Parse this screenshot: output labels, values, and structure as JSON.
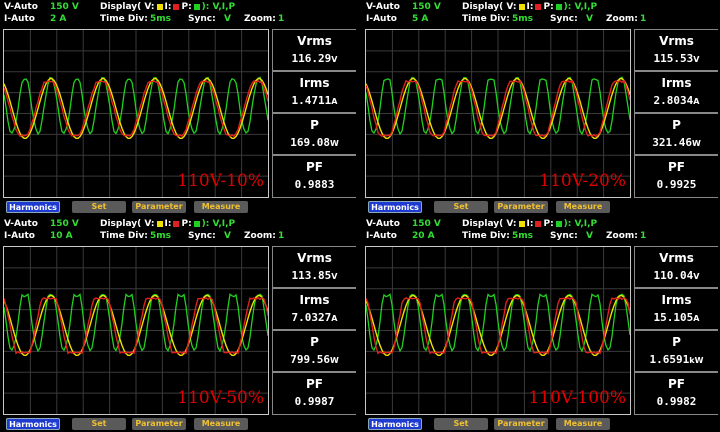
{
  "labels": {
    "v_auto": "V-Auto",
    "i_auto": "I-Auto",
    "display": "Display( V:",
    "display_i": "I:",
    "display_p": "P:",
    "display_end": "): V,I,P",
    "time_div": "Time Div:",
    "time_div_value": "5ms",
    "sync": "Sync:",
    "sync_value": "V",
    "zoom": "Zoom:",
    "zoom_value": "1",
    "m_vrms": "Vrms",
    "m_irms": "Irms",
    "m_p": "P",
    "m_pf": "PF",
    "btn_harmonics": "Harmonics",
    "btn_set": "Set",
    "btn_parameter": "Parameter",
    "btn_measure": "Measure"
  },
  "colors": {
    "voltage": "#f0e000",
    "current": "#e02020",
    "power": "#20d020",
    "panel_label": "#e00000"
  },
  "panels": [
    {
      "v_range": "150 V",
      "i_range": "2 A",
      "label": "110V-10%",
      "vrms": "116.29",
      "vrms_unit": "V",
      "irms": "1.4711",
      "irms_unit": "A",
      "p": "169.08",
      "p_unit": "W",
      "pf": "0.9883"
    },
    {
      "v_range": "150 V",
      "i_range": "5 A",
      "label": "110V-20%",
      "vrms": "115.53",
      "vrms_unit": "V",
      "irms": "2.8034",
      "irms_unit": "A",
      "p": "321.46",
      "p_unit": "W",
      "pf": "0.9925"
    },
    {
      "v_range": "150 V",
      "i_range": "10 A",
      "label": "110V-50%",
      "vrms": "113.85",
      "vrms_unit": "V",
      "irms": "7.0327",
      "irms_unit": "A",
      "p": "799.56",
      "p_unit": "W",
      "pf": "0.9987"
    },
    {
      "v_range": "150 V",
      "i_range": "20 A",
      "label": "110V-100%",
      "vrms": "110.04",
      "vrms_unit": "V",
      "irms": "15.105",
      "irms_unit": "A",
      "p": "1.6591",
      "p_unit": "kW",
      "pf": "0.9982"
    }
  ]
}
